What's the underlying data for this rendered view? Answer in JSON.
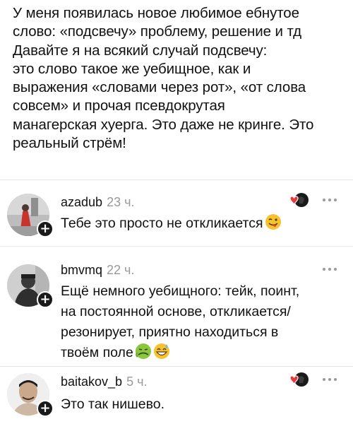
{
  "post": {
    "lines": [
      "У меня появилась новое любимое ебнутое",
      "слово: «подсвечу» проблему, решение и тд",
      "Давайте я на всякий случай подсвечу:",
      "это слово такое же уебищное, как и",
      "выражения «словами через рот», «от слова",
      "совсем» и прочая псевдокрутая",
      "манагерская хуерга. Это даже не кринге. Это",
      "реальный стрём!"
    ]
  },
  "comments": [
    {
      "username": "azadub",
      "time": "23 ч.",
      "lines": [
        "Тебе это просто не откликается"
      ],
      "emoji": [
        "tongue-wink-emoji"
      ],
      "liked_by_author": true
    },
    {
      "username": "bmvmq",
      "time": "22 ч.",
      "lines": [
        "Ещё немного уебищного: тейк, поинт,",
        "на постоянной основе, откликается/",
        "резонирует, приятно находиться в",
        "твоём поле"
      ],
      "emoji": [
        "nauseated-emoji",
        "grinning-sweat-emoji"
      ],
      "liked_by_author": false
    },
    {
      "username": "baitakov_b",
      "time": "5 ч.",
      "lines": [
        "Это так нишево."
      ],
      "emoji": [],
      "liked_by_author": true
    }
  ],
  "colors": {
    "text": "#111111",
    "meta": "#9a9a9a",
    "heart": "#e8383d",
    "divider": "#e7e7e7"
  }
}
